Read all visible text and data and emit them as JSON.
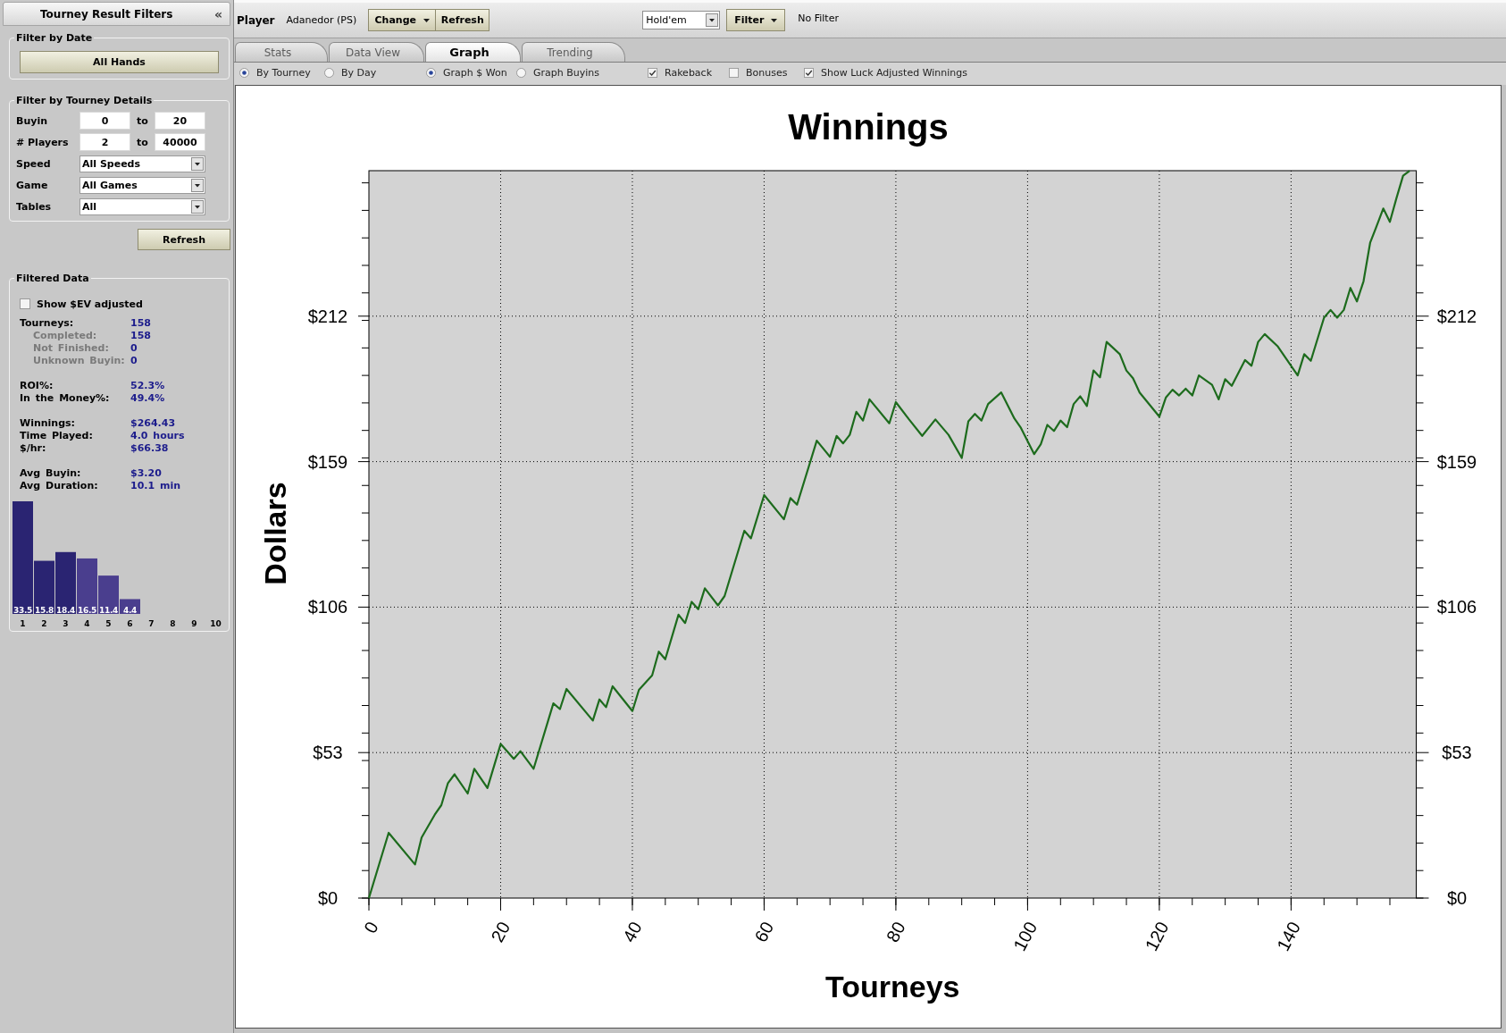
{
  "sidebar": {
    "title": "Tourney Result Filters",
    "collapse": "«",
    "date_filter": {
      "legend": "Filter by Date",
      "button": "All Hands"
    },
    "tourney_filter": {
      "legend": "Filter by Tourney Details",
      "ranges": [
        {
          "label": "Buyin",
          "from": "0",
          "joiner": "to",
          "to": "20"
        },
        {
          "label": "# Players",
          "from": "2",
          "joiner": "to",
          "to": "40000"
        }
      ],
      "dropdowns": [
        {
          "label": "Speed",
          "value": "All Speeds"
        },
        {
          "label": "Game",
          "value": "All Games"
        },
        {
          "label": "Tables",
          "value": "All"
        }
      ]
    },
    "refresh_button": "Refresh",
    "filtered_data": {
      "legend": "Filtered Data",
      "ev_checkbox": {
        "label": "Show $EV adjusted",
        "checked": false
      },
      "stat_groups": [
        {
          "rows": [
            {
              "kind": "main",
              "label": "Tourneys:",
              "value": "158"
            },
            {
              "kind": "sub",
              "label": "Completed:",
              "value": "158"
            },
            {
              "kind": "sub",
              "label": "Not Finished:",
              "value": "0"
            },
            {
              "kind": "sub",
              "label": "Unknown Buyin:",
              "value": "0"
            }
          ]
        },
        {
          "rows": [
            {
              "kind": "main",
              "label": "ROI%:",
              "value": "52.3%"
            },
            {
              "kind": "main",
              "label": "In the Money%:",
              "value": "49.4%"
            }
          ]
        },
        {
          "rows": [
            {
              "kind": "main",
              "label": "Winnings:",
              "value": "$264.43"
            },
            {
              "kind": "main",
              "label": "Time Played:",
              "value": "4.0 hours"
            },
            {
              "kind": "main",
              "label": "$/hr:",
              "value": "$66.38"
            }
          ]
        },
        {
          "rows": [
            {
              "kind": "main",
              "label": "Avg Buyin:",
              "value": "$3.20"
            },
            {
              "kind": "main",
              "label": "Avg Duration:",
              "value": "10.1 min"
            }
          ]
        }
      ],
      "finish_chart": {
        "chart_data": {
          "type": "bar",
          "categories": [
            "1",
            "2",
            "3",
            "4",
            "5",
            "6",
            "7",
            "8",
            "9",
            "10"
          ],
          "series": [
            {
              "color": "#2a2472",
              "values": [
                33.5,
                15.8,
                18.4,
                null,
                null,
                null,
                null,
                null,
                null,
                null
              ]
            },
            {
              "color": "#4a3e8e",
              "values": [
                null,
                null,
                null,
                16.5,
                11.4,
                4.4,
                null,
                null,
                null,
                null
              ]
            }
          ],
          "data_labels": true
        }
      }
    }
  },
  "toolbar": {
    "player_label": "Player",
    "player_name": "Adanedor (PS)",
    "buttons": [
      {
        "label": "Change",
        "has_menu": true
      },
      {
        "label": "Refresh",
        "has_menu": false
      }
    ],
    "game_select": "Hold'em",
    "filter_button": {
      "label": "Filter",
      "has_menu": true
    },
    "filter_status": "No Filter"
  },
  "tabs": [
    {
      "label": "Stats",
      "selected": false
    },
    {
      "label": "Data View",
      "selected": false
    },
    {
      "label": "Graph",
      "selected": true
    },
    {
      "label": "Trending",
      "selected": false
    }
  ],
  "options_bar": {
    "x_axis_options": [
      {
        "label": "By Tourney",
        "selected": true
      },
      {
        "label": "By Day",
        "selected": false
      }
    ],
    "value_options": [
      {
        "label": "Graph $ Won",
        "selected": true
      },
      {
        "label": "Graph Buyins",
        "selected": false
      }
    ],
    "include_options": [
      {
        "label": "Rakeback",
        "checked": true
      },
      {
        "label": "Bonuses",
        "checked": false
      },
      {
        "label": "Show Luck Adjusted Winnings",
        "checked": true
      }
    ]
  },
  "graph": {
    "chart_data": {
      "type": "line",
      "title": "Winnings",
      "xlabel": "Tourneys",
      "ylabel": "Dollars",
      "x": [
        0,
        3,
        7,
        8,
        10,
        11,
        12,
        13,
        15,
        16,
        18,
        20,
        22,
        23,
        25,
        28,
        29,
        30,
        34,
        35,
        36,
        37,
        40,
        41,
        43,
        44,
        45,
        47,
        48,
        49,
        50,
        51,
        53,
        54,
        57,
        58,
        60,
        63,
        64,
        65,
        68,
        70,
        71,
        72,
        73,
        74,
        75,
        76,
        79,
        80,
        82,
        84,
        86,
        88,
        90,
        91,
        92,
        93,
        94,
        96,
        98,
        99,
        101,
        102,
        103,
        104,
        105,
        106,
        107,
        108,
        109,
        110,
        111,
        112,
        114,
        115,
        116,
        117,
        120,
        121,
        122,
        123,
        124,
        125,
        126,
        128,
        129,
        130,
        131,
        133,
        134,
        135,
        136,
        138,
        141,
        142,
        143,
        145,
        146,
        147,
        148,
        149,
        150,
        151,
        152,
        153,
        154,
        155,
        156,
        157,
        158
      ],
      "series": [
        {
          "color": "#1d6b1d",
          "values": [
            0,
            23.7,
            12.2,
            22,
            30.3,
            33.8,
            41.8,
            45,
            38,
            47,
            40,
            56,
            50.6,
            53.4,
            47,
            70.8,
            68.7,
            76,
            64.5,
            72.2,
            69.4,
            77,
            68,
            75.7,
            81,
            89.6,
            86.8,
            103,
            100,
            107.7,
            105,
            112.6,
            106.4,
            109.8,
            133.5,
            130.8,
            146.5,
            137.7,
            145.4,
            143,
            166.3,
            160.4,
            168,
            165.3,
            168.4,
            176.8,
            173.6,
            181.3,
            172.6,
            180.3,
            174,
            168,
            174,
            168.4,
            160,
            173.3,
            176,
            173.6,
            179.6,
            183.8,
            174.3,
            170.9,
            161.4,
            165,
            172,
            169.8,
            173.6,
            171.2,
            179.6,
            182.4,
            178.9,
            191.8,
            189.3,
            202.2,
            197.7,
            191.8,
            189,
            183.8,
            175,
            182,
            184.8,
            182.7,
            185.2,
            182.7,
            190,
            186.6,
            181.3,
            188.6,
            186.2,
            195.6,
            193.5,
            202.2,
            205,
            200.5,
            190,
            197.7,
            195.3,
            211,
            213.8,
            211,
            213.8,
            221.8,
            216.9,
            224.2,
            238.2,
            244.4,
            250.7,
            245.8,
            254.5,
            262.6,
            264.4
          ]
        }
      ],
      "xlim": [
        0,
        159
      ],
      "ylim": [
        0,
        264.43
      ],
      "xticks": [
        0,
        20,
        40,
        60,
        80,
        100,
        120,
        140
      ],
      "yticks": [
        {
          "value": 0,
          "label": "$0"
        },
        {
          "value": 52.89,
          "label": "$53"
        },
        {
          "value": 105.77,
          "label": "$106"
        },
        {
          "value": 158.66,
          "label": "$159"
        },
        {
          "value": 211.54,
          "label": "$212"
        }
      ],
      "grid": true
    },
    "right_axis_labels": [
      "$212",
      "$159",
      "$106",
      "$53",
      "$0"
    ]
  }
}
